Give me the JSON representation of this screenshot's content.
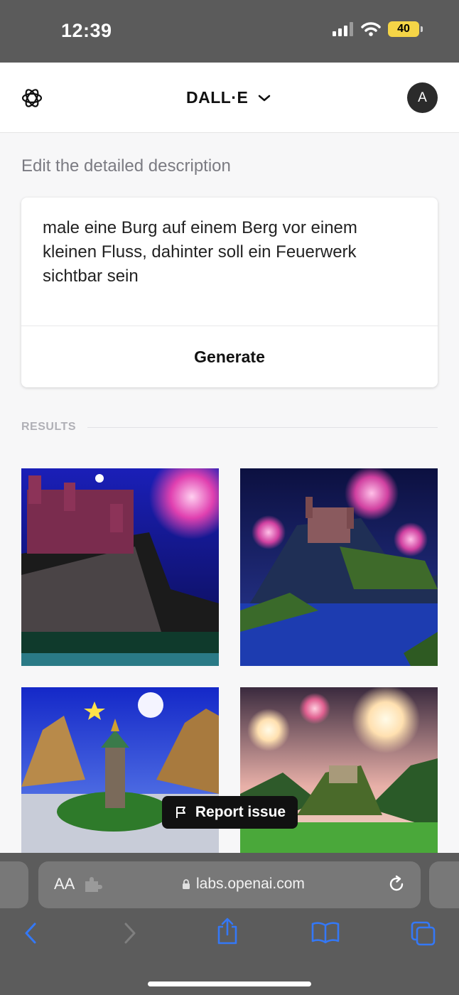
{
  "status_bar": {
    "time": "12:39",
    "battery": "40"
  },
  "header": {
    "title": "DALL·E",
    "avatar_initial": "A"
  },
  "editor": {
    "label": "Edit the detailed description",
    "prompt": "male eine Burg auf einem Berg vor einem kleinen Fluss, dahinter soll ein Feuerwerk sichtbar sein",
    "generate_label": "Generate"
  },
  "results": {
    "label": "RESULTS"
  },
  "report": {
    "label": "Report issue"
  },
  "browser": {
    "aa_label": "AA",
    "url": "labs.openai.com"
  },
  "colors": {
    "accent": "#3478f6",
    "status_bar": "#5b5b5b",
    "battery": "#f5d547"
  }
}
